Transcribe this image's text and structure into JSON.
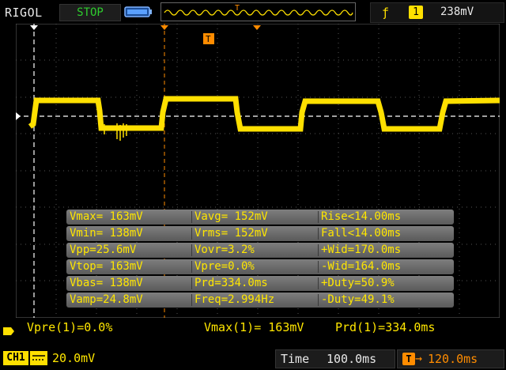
{
  "header": {
    "brand": "RIGOL",
    "run_status": "STOP",
    "trigger": {
      "edge_icon": "rising-edge-icon",
      "channel": "1",
      "level": "238mV"
    }
  },
  "markers": {
    "trigger_position_label": "T"
  },
  "measurements": {
    "rows": [
      [
        "Vmax= 163mV",
        "Vavg= 152mV",
        "Rise<14.00ms"
      ],
      [
        "Vmin= 138mV",
        "Vrms= 152mV",
        "Fall<14.00ms"
      ],
      [
        "Vpp=25.6mV",
        "Vovr=3.2%",
        "+Wid=170.0ms"
      ],
      [
        "Vtop= 163mV",
        "Vpre=0.0%",
        "-Wid=164.0ms"
      ],
      [
        "Vbas= 138mV",
        "Prd=334.0ms",
        "+Duty=50.9%"
      ],
      [
        "Vamp=24.8mV",
        "Freq=2.994Hz",
        "-Duty=49.1%"
      ]
    ]
  },
  "summary": {
    "items": [
      "Vpre(1)=0.0%",
      "Vmax(1)= 163mV",
      "Prd(1)=334.0ms"
    ]
  },
  "footer": {
    "channel_label": "CH1",
    "channel_scale": "20.0mV",
    "time_label": "Time",
    "time_scale": "100.0ms",
    "trigger_offset_icon": "T",
    "trigger_offset_arrow": "→",
    "trigger_offset": "120.0ms"
  },
  "colors": {
    "channel1": "#ffe000",
    "trigger": "#ff8c00",
    "status_stop": "#2ecc2e"
  }
}
